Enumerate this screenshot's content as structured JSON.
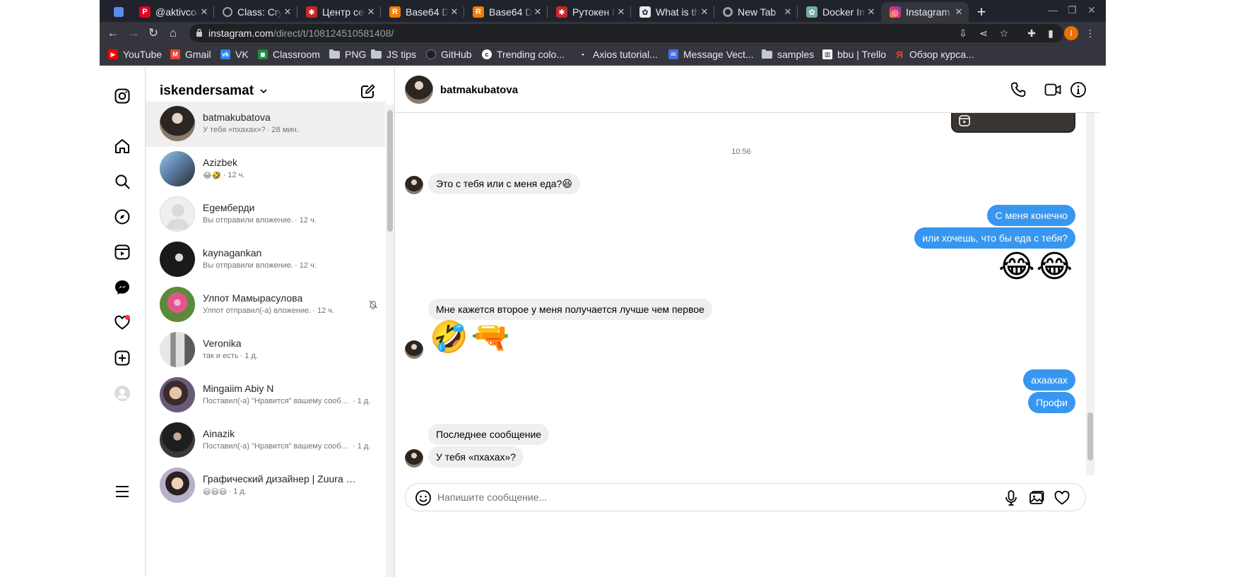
{
  "browser": {
    "tabs": [
      {
        "title": "",
        "icon": "tab-overview-icon",
        "color": "#5b8def"
      },
      {
        "title": "@aktivco/",
        "icon": "pinterest-icon",
        "color": "#e60023"
      },
      {
        "title": "Class: Cryp",
        "icon": "globe-icon",
        "color": "#9aa0a6"
      },
      {
        "title": "Центр сер",
        "icon": "rutoken-icon",
        "color": "#c62828"
      },
      {
        "title": "Base64 De",
        "icon": "r-icon",
        "color": "#f57c00"
      },
      {
        "title": "Base64 De",
        "icon": "r-icon",
        "color": "#f57c00"
      },
      {
        "title": "Рутокен П",
        "icon": "rutoken-icon",
        "color": "#c62828"
      },
      {
        "title": "What is th",
        "icon": "openai-icon",
        "color": "#e8eaed"
      },
      {
        "title": "New Tab",
        "icon": "chrome-icon",
        "color": "#9aa0a6"
      },
      {
        "title": "Docker Im",
        "icon": "openai-icon",
        "color": "#74aa9c"
      },
      {
        "title": "Instagram",
        "icon": "instagram-icon",
        "color": "#e1306c"
      }
    ],
    "url_host": "instagram.com",
    "url_path": "/direct/t/108124510581408/",
    "profile_initial": "I",
    "bookmarks": [
      {
        "label": "YouTube",
        "icon": "youtube-icon",
        "color": "#ff0000"
      },
      {
        "label": "Gmail",
        "icon": "gmail-icon",
        "color": "#ea4335"
      },
      {
        "label": "VK",
        "icon": "vk-icon",
        "color": "#2787f5"
      },
      {
        "label": "Classroom",
        "icon": "classroom-icon",
        "color": "#1e8e3e"
      },
      {
        "label": "PNG",
        "icon": "folder-icon",
        "color": "#c5c8cc"
      },
      {
        "label": "JS tips",
        "icon": "folder-icon",
        "color": "#c5c8cc"
      },
      {
        "label": "GitHub",
        "icon": "github-icon",
        "color": "#202124"
      },
      {
        "label": "Trending colo...",
        "icon": "color-icon",
        "color": "#ffffff"
      },
      {
        "label": "Axios tutorial...",
        "icon": "axios-icon",
        "color": "#ffffff"
      },
      {
        "label": "Message Vect...",
        "icon": "message-icon",
        "color": "#4a6ee0"
      },
      {
        "label": "samples",
        "icon": "folder-icon",
        "color": "#c5c8cc"
      },
      {
        "label": "bbu | Trello",
        "icon": "trello-icon",
        "color": "#ffffff"
      },
      {
        "label": "Обзор курса...",
        "icon": "yandex-icon",
        "color": "#fc3f1d"
      }
    ]
  },
  "inbox": {
    "username": "iskendersamat",
    "conversations": [
      {
        "name": "batmakubatova",
        "preview": "У тебя «пхахах»?",
        "time": "· 28 мин.",
        "avatar": "#2b2622",
        "muted": false
      },
      {
        "name": "Azizbek",
        "preview": "😂🤣",
        "time": "· 12 ч.",
        "avatar": "#5b7fa6",
        "muted": false
      },
      {
        "name": "Egeмберди",
        "preview": "Вы отправили вложение.",
        "time": "· 12 ч.",
        "avatar": "#dbdbdb",
        "muted": false
      },
      {
        "name": "kaynagankan",
        "preview": "Вы отправили вложение.",
        "time": "· 12 ч.",
        "avatar": "#1a1a1a",
        "muted": false
      },
      {
        "name": "Улпот Мамырасулова",
        "preview": "Улпот отправил(-а) вложение.",
        "time": "· 12 ч.",
        "avatar": "#d65a8a",
        "muted": true
      },
      {
        "name": "Veronika",
        "preview": "так и есть",
        "time": "· 1 д.",
        "avatar": "#8c8c8c",
        "muted": false
      },
      {
        "name": "Mingaiim Abiy N",
        "preview": "Поставил(-а) \"Нравится\" вашему сообщ...",
        "time": "· 1 д.",
        "avatar": "#6a5a7a",
        "muted": false
      },
      {
        "name": "Ainazik",
        "preview": "Поставил(-а) \"Нравится\" вашему сообщ...",
        "time": "· 1 д.",
        "avatar": "#3a3a3a",
        "muted": false
      },
      {
        "name": "Графический дизайнер | Zuura Ku...",
        "preview": "😃😃😃",
        "time": "· 1 д.",
        "avatar": "#7a6f8f",
        "muted": false
      }
    ]
  },
  "chat": {
    "name": "batmakubatova",
    "timestamp": "10:56",
    "messages": {
      "m1": "Это с тебя или с меня еда?😆",
      "m2": "С меня конечно",
      "m3": "или хочешь, что бы еда с тебя?",
      "m4": "😂😂",
      "m5": "Мне кажется второе у меня получается лучше чем первое",
      "m6": "🤣🔫",
      "m7": "ахаахах",
      "m8": "Профи",
      "m9": "Последнее сообщение",
      "m10": "У тебя «пхахах»?"
    },
    "composer_placeholder": "Напишите сообщение..."
  },
  "colors": {
    "accent": "#3797f0",
    "incoming": "#efefef",
    "notification": "#ff3040"
  }
}
